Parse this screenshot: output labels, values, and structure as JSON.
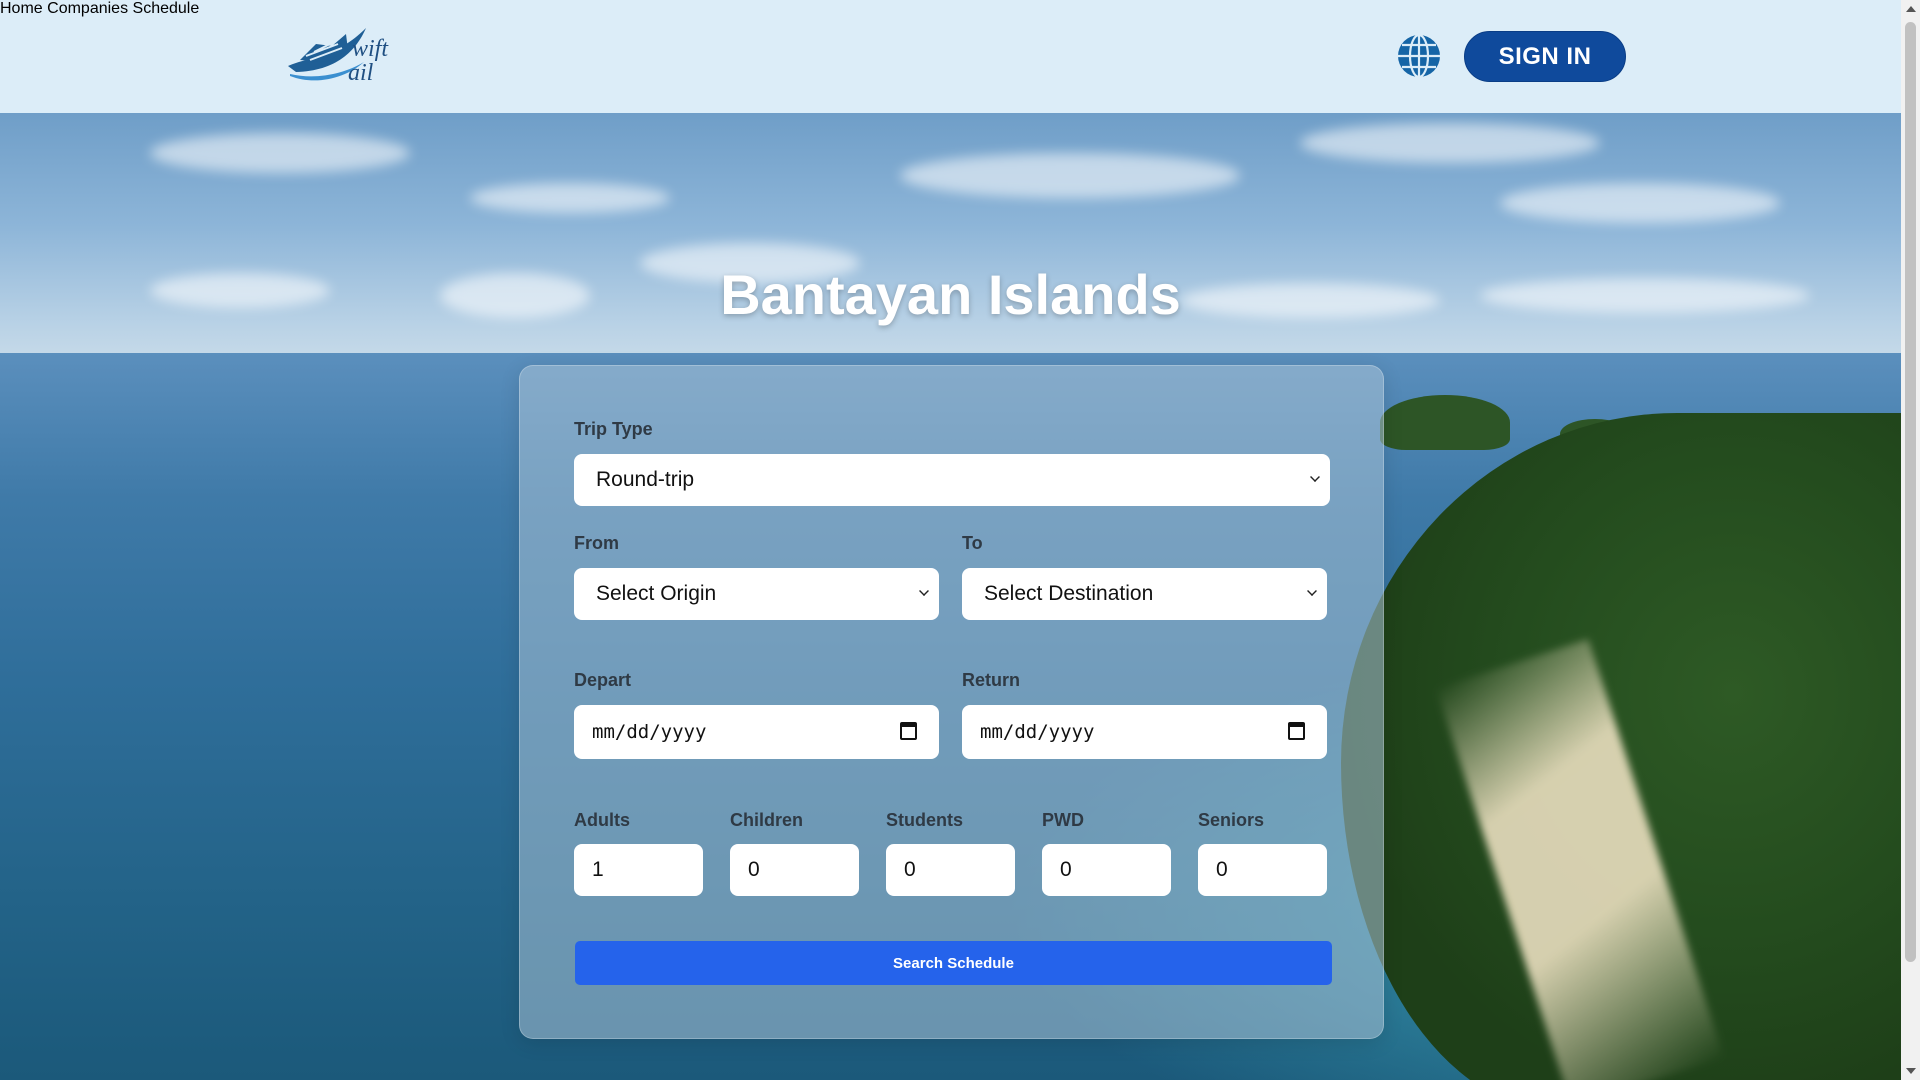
{
  "header": {
    "logo_text": "wift ail",
    "nav": [
      "Home",
      "Companies",
      "Schedule"
    ],
    "signin_label": "SIGN IN"
  },
  "hero": {
    "title": "Bantayan Islands"
  },
  "form": {
    "trip_type": {
      "label": "Trip Type",
      "value": "Round-trip"
    },
    "from": {
      "label": "From",
      "value": "Select Origin"
    },
    "to": {
      "label": "To",
      "value": "Select Destination"
    },
    "depart": {
      "label": "Depart",
      "value": "mm/dd/yyyy"
    },
    "return": {
      "label": "Return",
      "value": "mm/dd/yyyy"
    },
    "passengers": [
      {
        "label": "Adults",
        "value": "1"
      },
      {
        "label": "Children",
        "value": "0"
      },
      {
        "label": "Students",
        "value": "0"
      },
      {
        "label": "PWD",
        "value": "0"
      },
      {
        "label": "Seniors",
        "value": "0"
      }
    ],
    "search_label": "Search Schedule"
  },
  "colors": {
    "header_bg": "#dcedf8",
    "nav_text": "#1565a6",
    "signin_bg": "#0f4a9c",
    "search_button": "#2563eb"
  }
}
